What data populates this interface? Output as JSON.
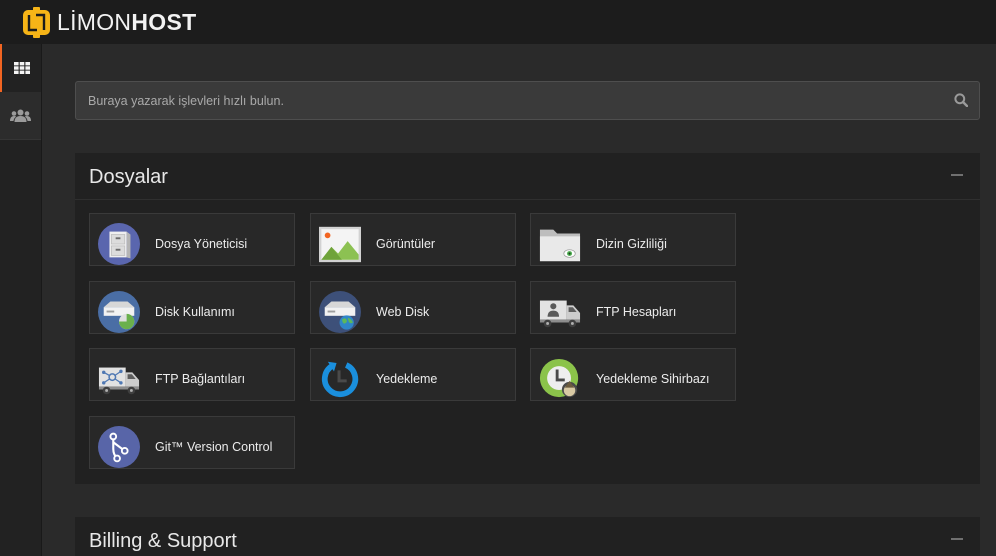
{
  "brand": {
    "name_light": "LİMON",
    "name_bold": "HOST",
    "logo_icon": "limon-logo-icon"
  },
  "sidebar": {
    "items": [
      {
        "icon": "grid-icon",
        "active": true
      },
      {
        "icon": "users-icon",
        "active": false
      }
    ]
  },
  "search": {
    "placeholder": "Buraya yazarak işlevleri hızlı bulun.",
    "icon": "search-icon"
  },
  "panels": [
    {
      "title": "Dosyalar",
      "collapse_icon": "minus-icon",
      "items": [
        {
          "label": "Dosya Yöneticisi",
          "icon": "file-manager-icon"
        },
        {
          "label": "Görüntüler",
          "icon": "images-icon"
        },
        {
          "label": "Dizin Gizliliği",
          "icon": "directory-privacy-icon"
        },
        {
          "label": "Disk Kullanımı",
          "icon": "disk-usage-icon"
        },
        {
          "label": "Web Disk",
          "icon": "web-disk-icon"
        },
        {
          "label": "FTP Hesapları",
          "icon": "ftp-accounts-icon"
        },
        {
          "label": "FTP Bağlantıları",
          "icon": "ftp-connections-icon"
        },
        {
          "label": "Yedekleme",
          "icon": "backup-icon"
        },
        {
          "label": "Yedekleme Sihirbazı",
          "icon": "backup-wizard-icon"
        },
        {
          "label": "Git™ Version Control",
          "icon": "git-icon"
        }
      ]
    },
    {
      "title": "Billing & Support",
      "collapse_icon": "minus-icon"
    }
  ],
  "colors": {
    "accent": "#f26522",
    "brand_yellow": "#f6b417",
    "header_bg": "#1c1c1c",
    "page_bg": "#2a2a2a",
    "panel_bg": "#212121",
    "text": "#e4e4e4"
  }
}
